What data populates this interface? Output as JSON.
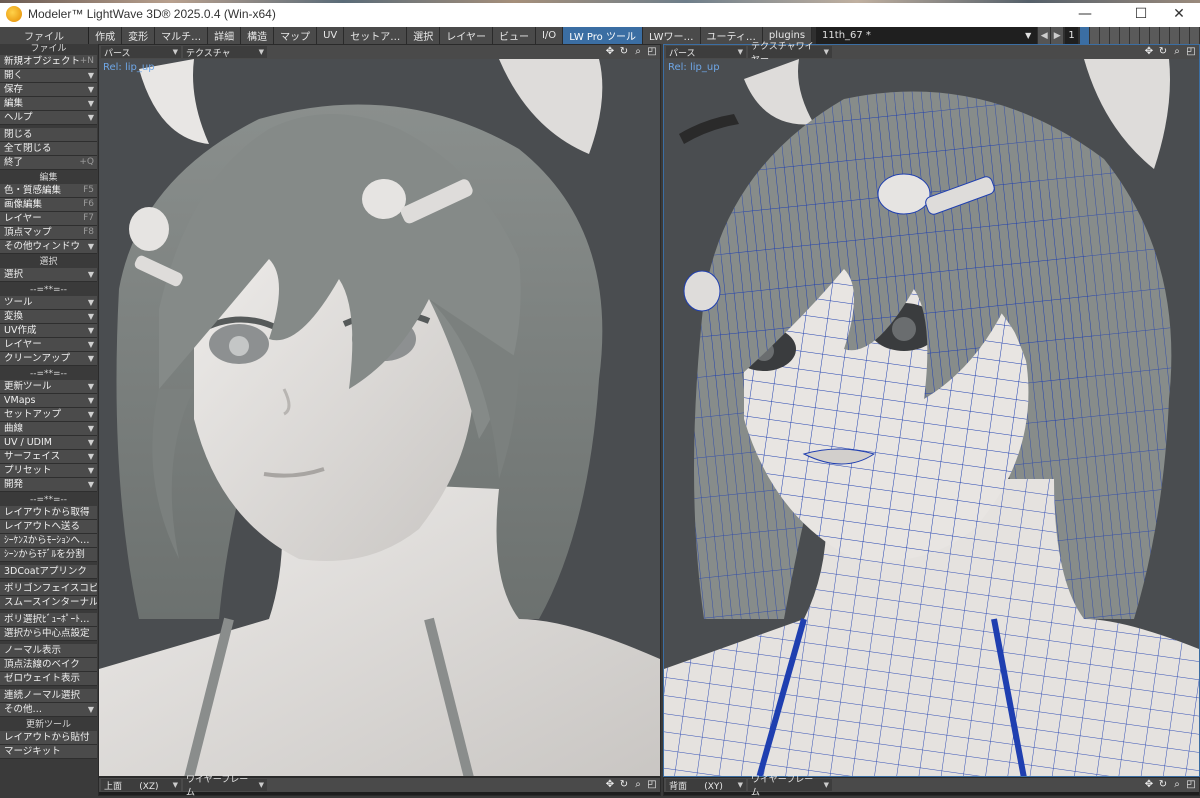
{
  "window": {
    "title": "Modeler™ LightWave 3D® 2025.0.4 (Win-x64)",
    "controls": {
      "minimize": "—",
      "maximize": "☐",
      "close": "✕"
    }
  },
  "tabbar": {
    "file_tab": "ファイル",
    "tabs": [
      "作成",
      "変形",
      "マルチ…",
      "詳細",
      "構造",
      "マップ",
      "UV",
      "セットア…",
      "選択",
      "レイヤー",
      "ビュー",
      "I/O",
      "LW Pro ツール",
      "LWワー…",
      "ユーティ…",
      "plugins"
    ],
    "active_tab": "LW Pro ツール",
    "scene_name": "11th_67 *",
    "layer_number": "1"
  },
  "sidebar": {
    "file_items": [
      {
        "label": "新規オブジェクト",
        "shortcut": "+N"
      },
      {
        "label": "開く",
        "arrow": "▼"
      },
      {
        "label": "保存",
        "arrow": "▼"
      },
      {
        "label": "編集",
        "arrow": "▼"
      },
      {
        "label": "ヘルプ",
        "arrow": "▼"
      }
    ],
    "close_items": [
      {
        "label": "閉じる"
      },
      {
        "label": "全て閉じる"
      },
      {
        "label": "終了",
        "shortcut": "+Q"
      }
    ],
    "edit_header": "編集",
    "edit_items": [
      {
        "label": "色・質感編集",
        "shortcut": "F5"
      },
      {
        "label": "画像編集",
        "shortcut": "F6"
      },
      {
        "label": "レイヤー",
        "shortcut": "F7"
      },
      {
        "label": "頂点マップ",
        "shortcut": "F8"
      },
      {
        "label": "その他ウィンドウ",
        "arrow": "▼"
      }
    ],
    "select_header": "選択",
    "select_items": [
      {
        "label": "選択",
        "arrow": "▼"
      }
    ],
    "sep1_header": "--=**=--",
    "group1_items": [
      {
        "label": "ツール",
        "arrow": "▼"
      },
      {
        "label": "変換",
        "arrow": "▼"
      },
      {
        "label": "UV作成",
        "arrow": "▼"
      },
      {
        "label": "レイヤー",
        "arrow": "▼"
      },
      {
        "label": "クリーンアップ",
        "arrow": "▼"
      }
    ],
    "sep2_header": "--=**=--",
    "group2_items": [
      {
        "label": "更新ツール",
        "arrow": "▼"
      },
      {
        "label": "VMaps",
        "arrow": "▼"
      },
      {
        "label": "セットアップ",
        "arrow": "▼"
      },
      {
        "label": "曲線",
        "arrow": "▼"
      },
      {
        "label": "UV / UDIM",
        "arrow": "▼"
      },
      {
        "label": "サーフェイス",
        "arrow": "▼"
      },
      {
        "label": "プリセット",
        "arrow": "▼"
      },
      {
        "label": "開発",
        "arrow": "▼"
      }
    ],
    "sep3_header": "--=**=--",
    "group3_items": [
      {
        "label": "レイアウトから取得"
      },
      {
        "label": "レイアウトへ送る"
      },
      {
        "label": "ｼｰｹﾝｽからﾓｰｼｮﾝへ…"
      },
      {
        "label": "ｼｰﾝからﾓﾃﾞﾙを分割"
      }
    ],
    "group4_items": [
      {
        "label": "3DCoatアプリンク"
      }
    ],
    "group5_items": [
      {
        "label": "ポリゴンフェイスコピー"
      },
      {
        "label": "スムースインターナル"
      }
    ],
    "group6_items": [
      {
        "label": "ポリ選択ﾋﾞｭｰﾎﾟｰﾄ…"
      },
      {
        "label": "選択から中心点設定"
      }
    ],
    "group7_items": [
      {
        "label": "ノーマル表示"
      },
      {
        "label": "頂点法線のベイク"
      },
      {
        "label": "ゼロウェイト表示"
      }
    ],
    "group8_items": [
      {
        "label": "連続ノーマル選択"
      },
      {
        "label": "その他…",
        "arrow": "▼"
      }
    ],
    "update_header": "更新ツール",
    "update_items": [
      {
        "label": "レイアウトから貼付"
      },
      {
        "label": "マージキット"
      }
    ]
  },
  "viewports": [
    {
      "projection": "パース",
      "render_mode": "テクスチャ",
      "label": "Rel: lip_up"
    },
    {
      "projection": "パース",
      "render_mode": "テクスチャワイヤー",
      "label": "Rel: lip_up"
    },
    {
      "projection": "上面",
      "axis": "(XZ)",
      "render_mode": "ワイヤーフレーム"
    },
    {
      "projection": "背面",
      "axis": "(XY)",
      "render_mode": "ワイヤーフレーム"
    }
  ],
  "colors": {
    "accent": "#3b6ea3",
    "label_blue": "#6ea6e6",
    "wire_blue": "#1f3fb0",
    "viewport_bg": "#4a4d50",
    "skin": "#e4e1de",
    "hair": "#7e8381"
  }
}
